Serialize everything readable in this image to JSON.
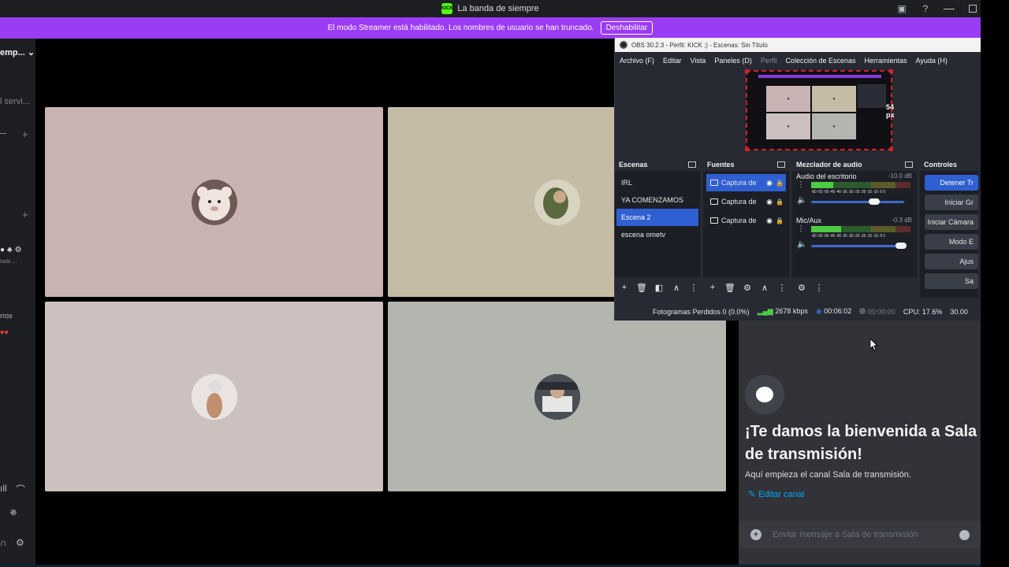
{
  "titlebar": {
    "app_title": "La banda de siempre",
    "app_icon_text": "KICK"
  },
  "banner": {
    "message": "El modo Streamer está habilitado. Los nombres de usuario se han truncado.",
    "disable_button": "Deshabilitar"
  },
  "left_sidebar": {
    "server_name": "emp...",
    "channel_partial": "l servi...",
    "status_partial": "tado ...",
    "section_partial": "rros"
  },
  "video_tiles": [
    {
      "bg": "#c8b3b2",
      "avatar": "teddy-bear-avatar"
    },
    {
      "bg": "#c5bca6",
      "avatar": "user-avatar-2"
    },
    {
      "bg": "#ccc1bf",
      "avatar": "user-avatar-3"
    },
    {
      "bg": "#b3b6ae",
      "avatar": "user-avatar-4"
    }
  ],
  "obs": {
    "window_title": "OBS 30.2.3 - Perfil: KICK ;) - Escenas: Sin Título",
    "menu": [
      "Archivo (F)",
      "Editar",
      "Vista",
      "Paneles (D)",
      "Perfil",
      "Colección de Escenas",
      "Herramientas",
      "Ayuda (H)"
    ],
    "preview_label": "54 px",
    "scenes": {
      "header": "Escenas",
      "items": [
        "IRL",
        "YA COMENZAMOS",
        "Escena 2",
        "escena ometv"
      ],
      "selected_index": 2
    },
    "sources": {
      "header": "Fuentes",
      "items": [
        "Captura de",
        "Captura de",
        "Captura de"
      ]
    },
    "mixer": {
      "header": "Mezclador de audio",
      "tracks": [
        {
          "name": "Audio del escritorio",
          "db": "-10.0 dB",
          "level": 0.22,
          "volume": 0.68
        },
        {
          "name": "Mic/Aux",
          "db": "-0.3 dB",
          "level": 0.3,
          "volume": 0.97
        }
      ],
      "scale": "-60 -55 -50 -45 -40 -35 -30 -25 -20 -15 -10 -5 0"
    },
    "controls": {
      "header": "Controles",
      "buttons": [
        "Detener Tr",
        "Iniciar Gr",
        "Iniciar Cámara",
        "Modo E",
        "Ajus",
        "Sa"
      ]
    },
    "status": {
      "dropped": "Fotogramas Perdidos 0 (0.0%)",
      "bitrate": "2678 kbps",
      "stream_time": "00:06:02",
      "rec_time": "00:00:00",
      "cpu": "CPU: 17.6%",
      "fps": "30.00"
    }
  },
  "chat": {
    "welcome_title": "¡Te damos la bienvenida a Sala de transmisión!",
    "welcome_sub": "Aquí empieza el canal Sala de transmisión.",
    "edit_channel": "Editar canal",
    "input_placeholder": "Enviar mensaje a Sala de transmisión"
  }
}
